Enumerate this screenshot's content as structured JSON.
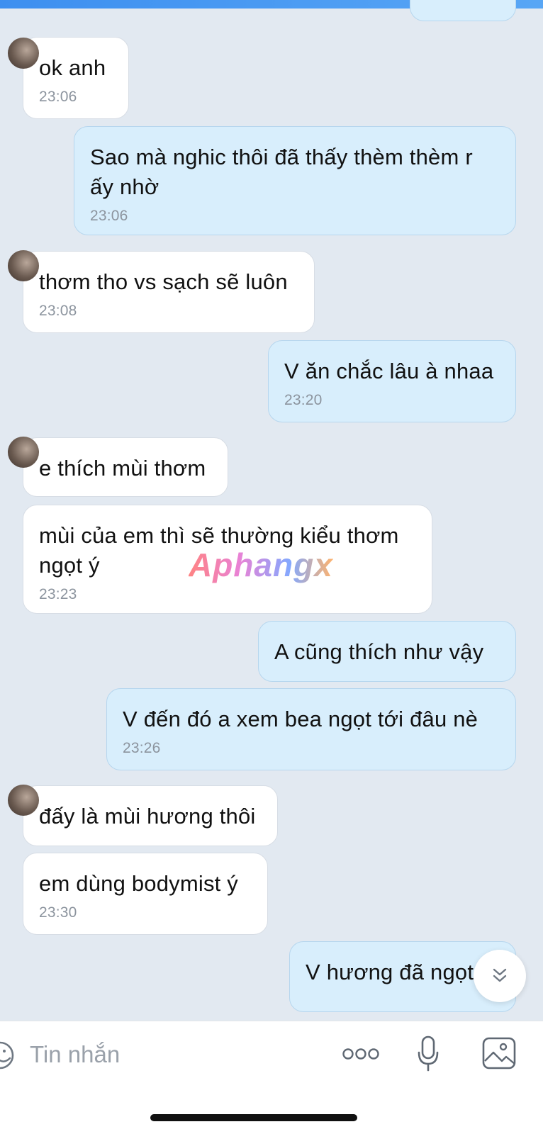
{
  "chat": {
    "messages": [
      {
        "direction": "in",
        "text": "ok anh",
        "time": "23:06"
      },
      {
        "direction": "out",
        "lines": [
          "Sao mà nghic thôi đã thấy thèm thèm r",
          "ấy nhờ"
        ],
        "time": "23:06"
      },
      {
        "direction": "in",
        "text": "thơm tho vs sạch sẽ luôn",
        "time": "23:08"
      },
      {
        "direction": "out",
        "text": "V ăn chắc lâu à nhaa",
        "time": "23:20"
      },
      {
        "direction": "in",
        "text": "e thích mùi thơm"
      },
      {
        "direction": "in",
        "lines": [
          "mùi của em thì sẽ thường kiểu thơm",
          "ngọt ý"
        ],
        "time": "23:23"
      },
      {
        "direction": "out",
        "text": "A cũng thích như vậy"
      },
      {
        "direction": "out",
        "text": "V đến đó a xem bea ngọt tới đâu nè",
        "time": "23:26"
      },
      {
        "direction": "in",
        "text": "đấy là mùi hương thôi"
      },
      {
        "direction": "in",
        "text": "em dùng bodymist ý",
        "time": "23:30"
      },
      {
        "direction": "out",
        "text": "V hương đã ngọt"
      }
    ]
  },
  "watermark": "Aphangx",
  "composer": {
    "placeholder": "Tin nhắn",
    "icons": [
      "sticker-icon",
      "more-icon",
      "microphone-icon",
      "image-icon"
    ]
  },
  "scroll_button_icon": "double-chevron-down-icon",
  "colors": {
    "background": "#e2e9f1",
    "incoming_bubble": "#ffffff",
    "outgoing_bubble": "#d8eefc",
    "accent": "#3d8ff0"
  }
}
